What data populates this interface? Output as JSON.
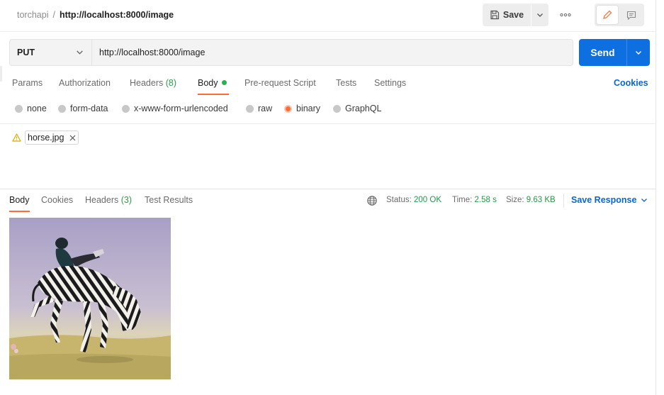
{
  "header": {
    "workspace": "torchapi",
    "separator": "/",
    "request_title": "http://localhost:8000/image",
    "save_label": "Save"
  },
  "request": {
    "method": "PUT",
    "url": "http://localhost:8000/image",
    "send_label": "Send"
  },
  "request_tabs": {
    "params": "Params",
    "authorization": "Authorization",
    "headers": "Headers",
    "headers_count": "(8)",
    "body": "Body",
    "pre_request": "Pre-request Script",
    "tests": "Tests",
    "settings": "Settings",
    "cookies": "Cookies",
    "active": "Body"
  },
  "body_types": {
    "options": [
      "none",
      "form-data",
      "x-www-form-urlencoded",
      "raw",
      "binary",
      "GraphQL"
    ],
    "selected": "binary"
  },
  "file": {
    "name": "horse.jpg",
    "warning_icon": "warning-icon",
    "remove_icon": "close-icon"
  },
  "response": {
    "tabs": {
      "body": "Body",
      "cookies": "Cookies",
      "headers": "Headers",
      "headers_count": "(3)",
      "test_results": "Test Results"
    },
    "status_label": "Status:",
    "status_value": "200 OK",
    "time_label": "Time:",
    "time_value": "2.58 s",
    "size_label": "Size:",
    "size_value": "9.63 KB",
    "save_response": "Save Response"
  },
  "colors": {
    "accent": "#ff6c37",
    "primary": "#0e6fe0",
    "link": "#0a66cf",
    "success": "#1f9a48"
  }
}
